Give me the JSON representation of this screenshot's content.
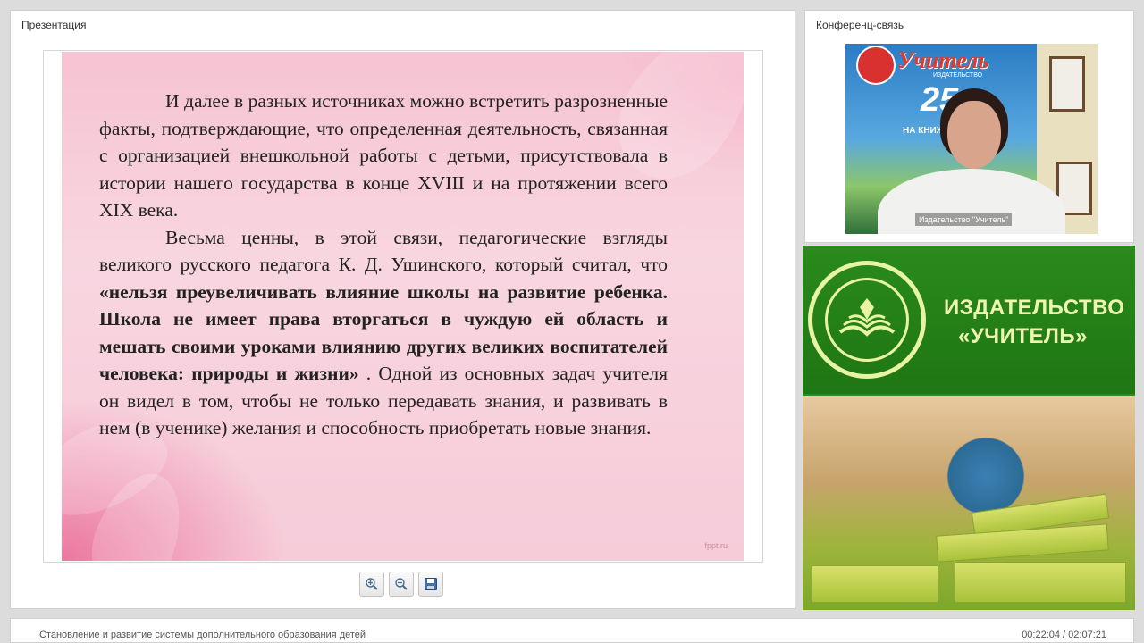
{
  "presentation": {
    "panel_title": "Презентация",
    "slide": {
      "paragraph1": "И далее в разных источниках можно встретить разрозненные факты, подтверждающие, что определенная деятельность, связанная с организацией внешкольной работы с детьми, присутствовала в истории нашего государства в конце XVIII и на протяжении всего XIX века.",
      "paragraph2_intro": "Весьма ценны, в этой связи, педагогические взгляды великого русского педагога К. Д. Ушинского, который считал, что ",
      "paragraph2_quote": "«нельзя преувеличивать влияние школы на развитие ребенка. Школа не имеет права вторгаться в чуждую ей область и мешать своими уроками влиянию других великих воспитателей человека: природы и жизни»",
      "paragraph2_rest": " . Одной из основных задач учителя он видел в том, чтобы не только передавать знания, и развивать в нем (в ученике) желания и способность приобретать новые знания.",
      "watermark": "fppt.ru"
    },
    "toolbar": {
      "zoom_in_icon": "zoom-in-icon",
      "zoom_out_icon": "zoom-out-icon",
      "save_icon": "save-icon"
    }
  },
  "conference": {
    "panel_title": "Конференц-связь",
    "video_label": "Издательство \"Учитель\"",
    "poster_brand": "Учитель",
    "poster_sub": "ИЗДАТЕЛЬСТВО",
    "poster_25": "25 л",
    "poster_caption": "НА КНИЖН"
  },
  "brand": {
    "line1": "ИЗДАТЕЛЬСТВО",
    "line2": "«УЧИТЕЛЬ»"
  },
  "footer": {
    "title": "Становление и развитие системы дополнительного образования детей",
    "time": "00:22:04 / 02:07:21"
  },
  "colors": {
    "brand_green": "#2a8a1b",
    "brand_text": "#eef5b0",
    "slide_pink": "#f6c3d2"
  }
}
